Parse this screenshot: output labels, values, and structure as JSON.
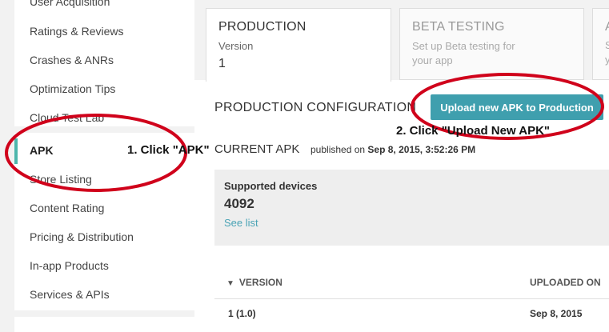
{
  "sidebar": {
    "items": [
      {
        "label": "User Acquisition"
      },
      {
        "label": "Ratings & Reviews"
      },
      {
        "label": "Crashes & ANRs"
      },
      {
        "label": "Optimization Tips"
      },
      {
        "label": "Cloud Test Lab"
      },
      {
        "label": "APK",
        "active": true
      },
      {
        "label": "Store Listing"
      },
      {
        "label": "Content Rating"
      },
      {
        "label": "Pricing & Distribution"
      },
      {
        "label": "In-app Products"
      },
      {
        "label": "Services & APIs"
      }
    ],
    "accent_color": "#4db6ac"
  },
  "tabs": [
    {
      "title": "PRODUCTION",
      "subtitle": "Version",
      "count": "1"
    },
    {
      "title": "BETA TESTING",
      "subtitle_line1": "Set up Beta testing for",
      "subtitle_line2": "your app"
    },
    {
      "title": "A",
      "line1": "S",
      "line2": "y"
    }
  ],
  "main": {
    "section_title": "PRODUCTION CONFIGURATION",
    "upload_button": "Upload new APK to Production",
    "current_apk": "CURRENT APK",
    "published_prefix": "published on",
    "published_date": "Sep 8, 2015, 3:52:26 PM",
    "devices": {
      "label": "Supported devices",
      "count": "4092",
      "link": "See list"
    },
    "table": {
      "headers": [
        "VERSION",
        "UPLOADED ON"
      ],
      "rows": [
        {
          "version": "1 (1.0)",
          "uploaded": "Sep 8, 2015"
        }
      ]
    }
  },
  "annotations": {
    "step1": "1. Click \"APK\"",
    "step2": "2. Click \"Upload New APK\"",
    "color": "#d0021b"
  }
}
